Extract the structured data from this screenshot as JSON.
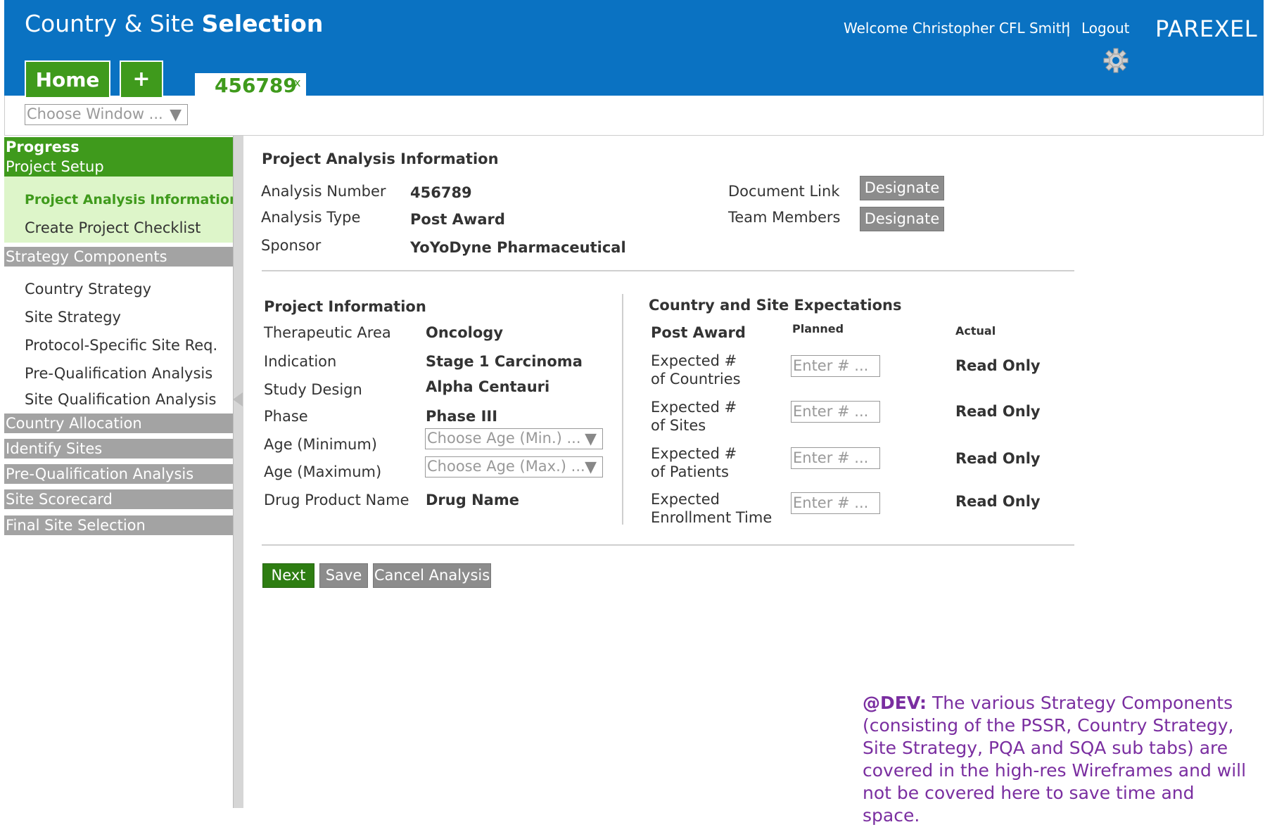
{
  "header": {
    "title_regular": "Country & Site",
    "title_bold": "Selection",
    "welcome": "Welcome Christopher CFL Smith",
    "separator": "|",
    "logout": "Logout",
    "brand": "PAREXEL",
    "tabs": {
      "home": "Home",
      "add": "+",
      "analysis": "456789",
      "close": "x"
    }
  },
  "window_select": {
    "placeholder": "Choose Window ...",
    "arrow": "▼"
  },
  "sidebar": {
    "progress": "Progress",
    "project_setup": "Project Setup",
    "project_analysis_information": "Project Analysis Information",
    "create_project_checklist": "Create Project Checklist",
    "strategy_components": "Strategy Components",
    "country_strategy": "Country Strategy",
    "site_strategy": "Site Strategy",
    "protocol_specific": "Protocol-Specific Site Req.",
    "pre_qualification_analysis_item": "Pre-Qualification Analysis",
    "site_qualification_analysis": "Site Qualification Analysis",
    "country_allocation": "Country Allocation",
    "identify_sites": "Identify Sites",
    "pre_qualification_analysis": "Pre-Qualification Analysis",
    "site_scorecard": "Site Scorecard",
    "final_site_selection": "Final Site Selection"
  },
  "analysis_info": {
    "heading": "Project Analysis Information",
    "analysis_number_label": "Analysis Number",
    "analysis_number": "456789",
    "analysis_type_label": "Analysis  Type",
    "analysis_type": "Post Award",
    "sponsor_label": "Sponsor",
    "sponsor": "YoYoDyne Pharmaceutical",
    "document_link_label": "Document Link",
    "team_members_label": "Team Members",
    "designate": "Designate"
  },
  "project_info": {
    "heading": "Project Information",
    "therapeutic_area_label": "Therapeutic Area",
    "therapeutic_area": "Oncology",
    "indication_label": "Indication",
    "indication": "Stage 1 Carcinoma",
    "study_design_label": "Study Design",
    "study_design": "Alpha Centauri",
    "phase_label": "Phase",
    "phase": "Phase III",
    "age_min_label": "Age (Minimum)",
    "age_min_placeholder": "Choose Age (Min.) ...",
    "age_max_label": "Age (Maximum)",
    "age_max_placeholder": "Choose Age (Max.) ...",
    "drug_label": "Drug Product Name",
    "drug": "Drug Name"
  },
  "expectations": {
    "heading": "Country and Site Expectations",
    "row_header": "Post Award",
    "planned_header": "Planned",
    "actual_header": "Actual",
    "input_placeholder": "Enter # ...",
    "read_only": "Read Only",
    "rows": [
      {
        "line1": "Expected #",
        "line2": "of Countries"
      },
      {
        "line1": "Expected #",
        "line2": "of Sites"
      },
      {
        "line1": "Expected #",
        "line2": "of Patients"
      },
      {
        "line1": "Expected",
        "line2": "Enrollment Time"
      }
    ]
  },
  "actions": {
    "next": "Next",
    "save": "Save",
    "cancel": "Cancel Analysis"
  },
  "note": {
    "tag": "@DEV:",
    "text": " The various Strategy Components (consisting of the PSSR, Country Strategy, Site Strategy, PQA and SQA sub tabs) are covered in the high-res Wireframes and will not be covered here to save time and space."
  },
  "colors": {
    "header_blue": "#0a72c2",
    "green": "#3f9a1c",
    "dark_green": "#2e7d12",
    "grey": "#a3a3a3",
    "note_purple": "#7a2ea0"
  },
  "icons": {
    "gear": "gear-icon",
    "dropdown": "chevron-down-icon"
  }
}
